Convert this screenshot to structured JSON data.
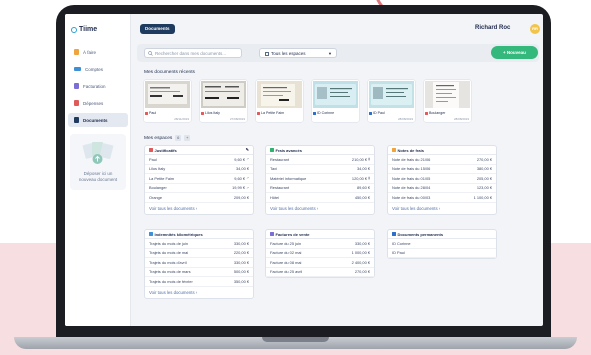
{
  "colors": {
    "sidebar_active": "#e3e8f1",
    "primary_dark": "#1f3a5f",
    "new_button": "#34b87c",
    "avatar": "#f2c54a",
    "accent_pink": "#f7dfe1",
    "arrow": "#e07880",
    "icon_justificatifs": "#e05a5a",
    "icon_frais_avances": "#2fb36f",
    "icon_notes_frais": "#f2a43c",
    "icon_indemnites": "#3d8fd6",
    "icon_factures_vente": "#7b6fd6",
    "icon_documents_permanents": "#2a6fc9"
  },
  "app": {
    "logo_text": "Tiime",
    "page_tab": "Documents"
  },
  "sidebar": {
    "items": [
      {
        "label": "À faire",
        "icon": "checklist-icon",
        "color": "#f2a43c"
      },
      {
        "label": "Comptes",
        "icon": "bank-icon",
        "color": "#3d8fd6"
      },
      {
        "label": "Facturation",
        "icon": "invoice-icon",
        "color": "#7b6fd6"
      },
      {
        "label": "Dépenses",
        "icon": "expense-icon",
        "color": "#e05a5a"
      },
      {
        "label": "Documents",
        "icon": "documents-icon",
        "color": "#1f3a5f"
      }
    ],
    "drop_zone": {
      "line1": "Déposer ici un",
      "line2": "nouveau document"
    }
  },
  "header": {
    "user_name": "Richard Roc",
    "avatar_initials": "RR"
  },
  "toolbar": {
    "search_placeholder": "Rechercher dans mes documents...",
    "space_select": "Tous les espaces",
    "new_button": "+ Nouveau"
  },
  "recent": {
    "title": "Mes documents récents",
    "items": [
      {
        "name": "Paul",
        "date": "28/11/2019",
        "type_color": "#e05a5a"
      },
      {
        "name": "Lilos Italy",
        "date": "27/08/2019",
        "type_color": "#e05a5a"
      },
      {
        "name": "La Petite Faim",
        "date": "",
        "type_color": "#e05a5a"
      },
      {
        "name": "ID Corinne",
        "date": "",
        "type_color": "#2a6fc9"
      },
      {
        "name": "ID Paul",
        "date": "28/08/2019",
        "type_color": "#2a6fc9"
      },
      {
        "name": "Boulanger",
        "date": "28/08/2019",
        "type_color": "#e05a5a"
      }
    ]
  },
  "spaces": {
    "title": "Mes espaces",
    "count": "6",
    "see_all": "Voir tous les documents  ›",
    "cards": [
      {
        "title": "Justificatifs",
        "rows": [
          {
            "label": "Paul",
            "amount": "9,60 €"
          },
          {
            "label": "Lilos Italy",
            "amount": "34,00 €"
          },
          {
            "label": "La Petite Faim",
            "amount": "9,60 €"
          },
          {
            "label": "Boulanger",
            "amount": "19,99 €"
          },
          {
            "label": "Orange",
            "amount": "209,00 €"
          }
        ]
      },
      {
        "title": "Frais avancés",
        "rows": [
          {
            "label": "Restaurant",
            "amount": "210,00 €"
          },
          {
            "label": "Taxi",
            "amount": "34,00 €"
          },
          {
            "label": "Matériel informatique",
            "amount": "120,00 €"
          },
          {
            "label": "Restaurant",
            "amount": "89,60 €"
          },
          {
            "label": "Hôtel",
            "amount": "450,00 €"
          }
        ]
      },
      {
        "title": "Notes de frais",
        "rows": [
          {
            "label": "Note de frais du 21/06",
            "amount": "270,00 €"
          },
          {
            "label": "Note de frais du 15/06",
            "amount": "380,00 €"
          },
          {
            "label": "Note de frais du 01/05",
            "amount": "205,00 €"
          },
          {
            "label": "Note de frais du 28/04",
            "amount": "123,00 €"
          },
          {
            "label": "Note de frais du 00/03",
            "amount": "1 100,00 €"
          }
        ]
      },
      {
        "title": "Indemnités kilométriques",
        "rows": [
          {
            "label": "Trajets du mois de juin",
            "amount": "330,00 €"
          },
          {
            "label": "Trajets du mois de mai",
            "amount": "220,00 €"
          },
          {
            "label": "Trajets du mois d'avril",
            "amount": "330,00 €"
          },
          {
            "label": "Trajets du mois de mars",
            "amount": "500,00 €"
          },
          {
            "label": "Trajets du mois de février",
            "amount": "350,00 €"
          }
        ]
      },
      {
        "title": "Factures de vente",
        "rows": [
          {
            "label": "Facture du 25 juin",
            "amount": "330,00 €"
          },
          {
            "label": "Facture du 02 mai",
            "amount": "1 000,00 €"
          },
          {
            "label": "Facture du 08 mai",
            "amount": "2 400,00 €"
          },
          {
            "label": "Facture du 25 avril",
            "amount": "270,00 €"
          }
        ]
      },
      {
        "title": "Documents permanents",
        "rows": [
          {
            "label": "ID Corinne",
            "amount": ""
          },
          {
            "label": "ID Paul",
            "amount": ""
          }
        ]
      }
    ]
  }
}
